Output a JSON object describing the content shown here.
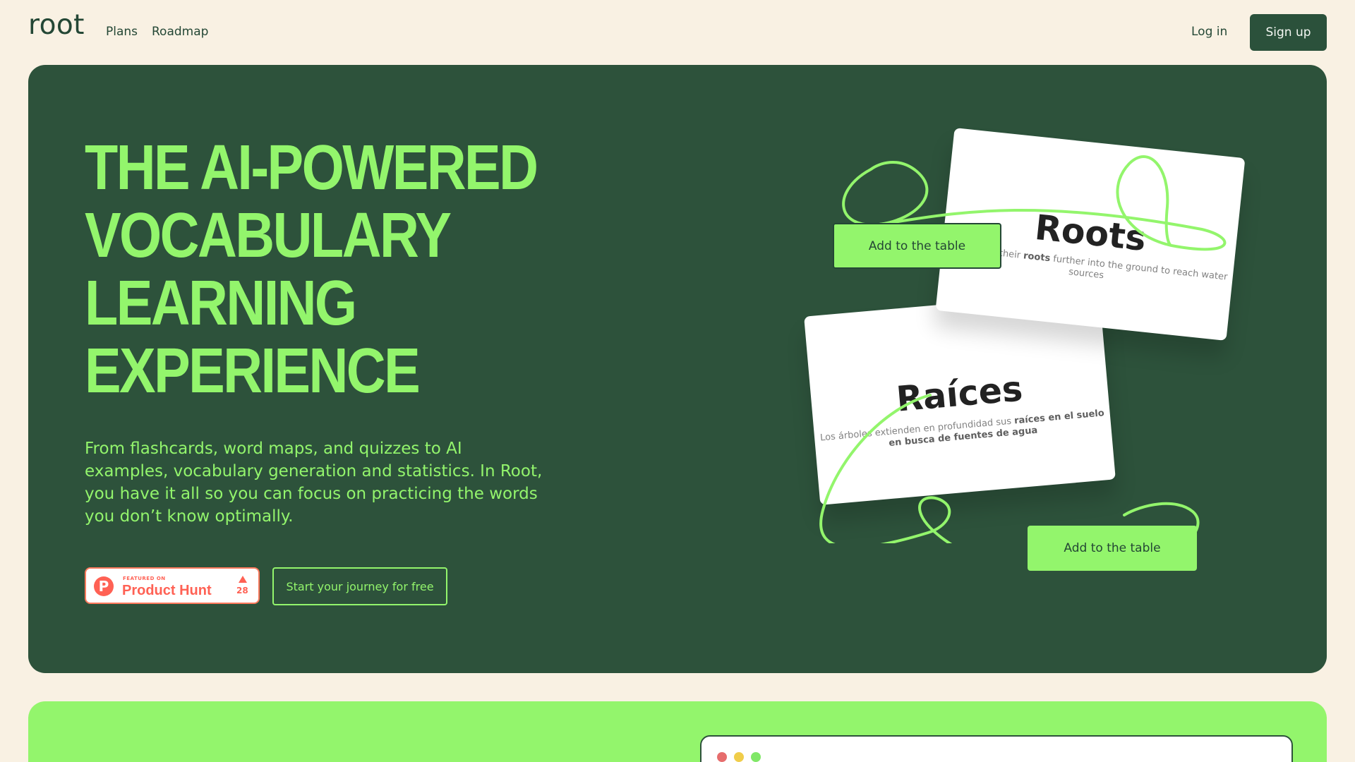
{
  "header": {
    "logo": "root",
    "nav": {
      "plans": "Plans",
      "roadmap": "Roadmap",
      "login": "Log in",
      "signup": "Sign up"
    }
  },
  "hero": {
    "headline_lines": [
      "THE AI-POWERED",
      "VOCABULARY",
      "LEARNING",
      "EXPERIENCE"
    ],
    "description": "From flashcards, word maps, and quizzes to AI examples, vocabulary generation and statistics. In Root, you have it all so you can focus on practicing the words you don’t know optimally.",
    "product_hunt": {
      "featured": "FEATURED ON",
      "title": "Product Hunt",
      "votes": "28"
    },
    "cta": "Start your journey for free",
    "cards": {
      "roots": {
        "word": "Roots",
        "sentence_before": "Trees grow their ",
        "sentence_strong": "roots",
        "sentence_after": " further into the ground to reach water sources"
      },
      "raices": {
        "word": "Raíces",
        "sentence_before": "Los árboles extienden en profundidad sus ",
        "sentence_strong": "raíces en el suelo en busca de fuentes de agua",
        "sentence_after": ""
      }
    },
    "add_to_table_top": "Add to the table",
    "add_to_table_bottom": "Add to the table"
  },
  "colors": {
    "page_background": "#f9f1e3",
    "primary_green": "#2d523b",
    "accent_lime": "#93f56c",
    "dark_text": "#244735",
    "product_hunt_orange": "#ff6154"
  },
  "icons": {
    "product_hunt_logo": "P",
    "upvote": "triangle-up"
  }
}
